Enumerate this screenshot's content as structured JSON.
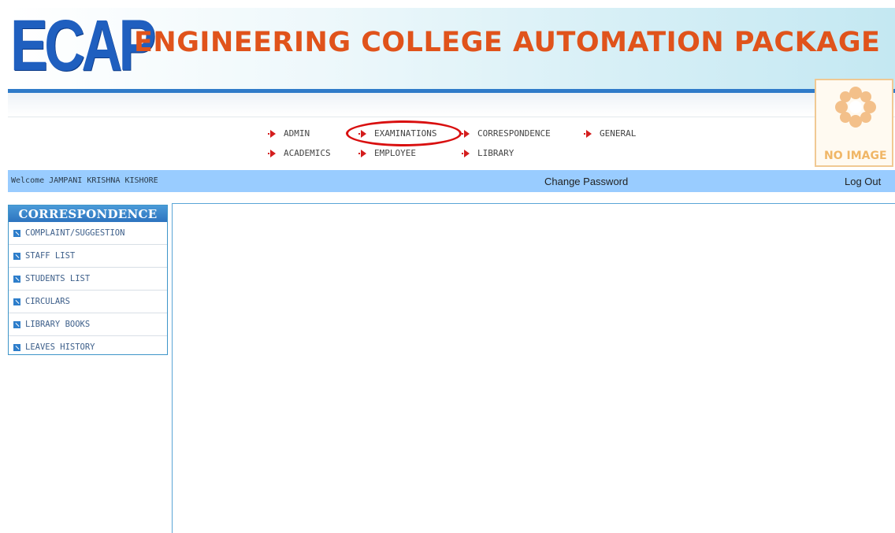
{
  "header": {
    "logo_text": "ECAP",
    "title": "ENGINEERING COLLEGE AUTOMATION PACKAGE"
  },
  "photo": {
    "text": "NO IMAGE"
  },
  "nav": {
    "admin": "ADMIN",
    "examinations": "EXAMINATIONS",
    "correspondence": "CORRESPONDENCE",
    "general": "GENERAL",
    "academics": "ACADEMICS",
    "employee": "EMPLOYEE",
    "library": "LIBRARY"
  },
  "welcome_bar": {
    "welcome": "Welcome JAMPANI KRISHNA KISHORE",
    "change_password": "Change Password",
    "logout": "Log Out"
  },
  "sidebar": {
    "title": "CORRESPONDENCE",
    "items": [
      {
        "label": "COMPLAINT/SUGGESTION"
      },
      {
        "label": "STAFF LIST"
      },
      {
        "label": "STUDENTS LIST"
      },
      {
        "label": "CIRCULARS"
      },
      {
        "label": "LIBRARY BOOKS"
      },
      {
        "label": "LEAVES HISTORY"
      }
    ]
  },
  "colors": {
    "accent_orange": "#e0531b",
    "logo_blue": "#1f5fbf",
    "bar_blue": "#99ccff",
    "highlight_red": "#d90f0f"
  }
}
